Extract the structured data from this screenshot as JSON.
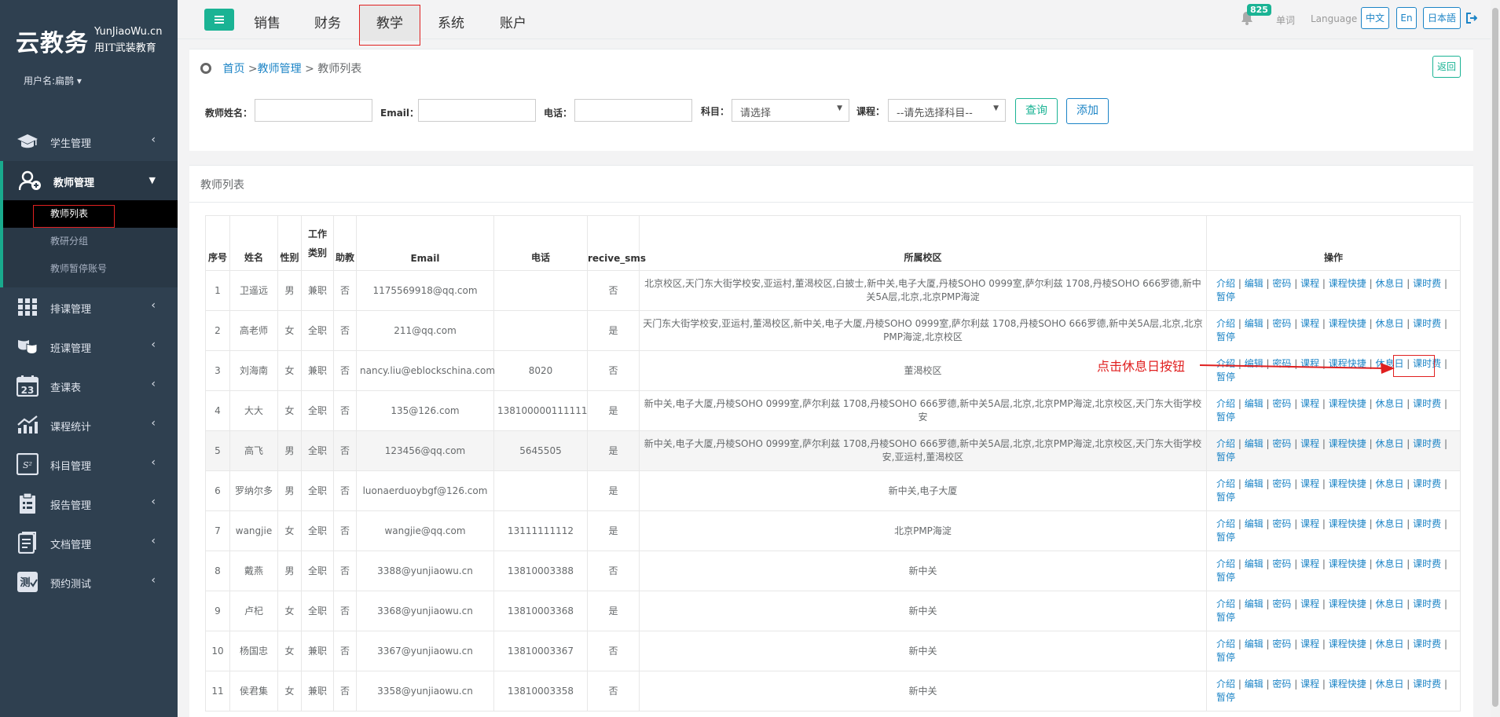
{
  "app": {
    "logo_cn": "云教务",
    "logo_en": "YunJiaoWu.cn",
    "slogan": "用IT武装教育",
    "user_label": "用户名:扁鹊 ▾"
  },
  "sidebar": {
    "items": [
      {
        "label": "学生管理",
        "icon": "graduation-cap-icon"
      },
      {
        "label": "教师管理",
        "icon": "teacher-icon"
      },
      {
        "label": "排课管理",
        "icon": "grid-icon"
      },
      {
        "label": "班课管理",
        "icon": "masks-icon"
      },
      {
        "label": "查课表",
        "icon": "calendar-icon"
      },
      {
        "label": "课程统计",
        "icon": "chart-icon"
      },
      {
        "label": "科目管理",
        "icon": "formula-icon"
      },
      {
        "label": "报告管理",
        "icon": "clipboard-icon"
      },
      {
        "label": "文档管理",
        "icon": "document-icon"
      },
      {
        "label": "预约测试",
        "icon": "test-icon"
      }
    ],
    "teacher_sub": [
      "教师列表",
      "教研分组",
      "教师暂停账号"
    ]
  },
  "topnav": {
    "tabs": [
      "销售",
      "财务",
      "教学",
      "系统",
      "账户"
    ],
    "active": "教学",
    "badge": "825",
    "vocab": "单词",
    "language_label": "Language :",
    "langs": [
      "中文",
      "En",
      "日本語"
    ]
  },
  "breadcrumb": {
    "home": "首页",
    "sep1": " >",
    "parent": "教师管理",
    "sep2": " > ",
    "current": "教师列表",
    "back": "返回"
  },
  "filters": {
    "name_label": "教师姓名：",
    "email_label": "Email：",
    "phone_label": "电话：",
    "subject_label": "科目：",
    "subject_value": "请选择",
    "course_label": "课程：",
    "course_value": "--请先选择科目--",
    "query_btn": "查询",
    "add_btn": "添加"
  },
  "list": {
    "title": "教师列表",
    "headers": [
      "序号",
      "姓名",
      "性别",
      "工作类别",
      "助教",
      "Email",
      "电话",
      "recive_sms",
      "所属校区",
      "操作"
    ],
    "ops": [
      "介绍",
      "编辑",
      "密码",
      "课程",
      "课程快捷",
      "休息日",
      "课时费",
      "暂停"
    ],
    "rows": [
      {
        "no": "1",
        "name": "卫遥远",
        "gender": "男",
        "type": "兼职",
        "assistant": "否",
        "email": "1175569918@qq.com",
        "phone": "",
        "sms": "否",
        "campus": "北京校区,天门东大街学校安,亚运村,董渴校区,白披士,新中关,电子大厦,丹棱SOHO 0999室,萨尔利兹 1708,丹棱SOHO 666罗德,新中关5A层,北京,北京PMP海淀"
      },
      {
        "no": "2",
        "name": "高老师",
        "gender": "女",
        "type": "全职",
        "assistant": "否",
        "email": "211@qq.com",
        "phone": "",
        "sms": "是",
        "campus": "天门东大街学校安,亚运村,董渴校区,新中关,电子大厦,丹棱SOHO 0999室,萨尔利兹 1708,丹棱SOHO 666罗德,新中关5A层,北京,北京PMP海淀,北京校区"
      },
      {
        "no": "3",
        "name": "刘海南",
        "gender": "女",
        "type": "兼职",
        "assistant": "否",
        "email": "nancy.liu@eblockschina.com",
        "phone": "8020",
        "sms": "否",
        "campus": "董渴校区"
      },
      {
        "no": "4",
        "name": "大大",
        "gender": "女",
        "type": "全职",
        "assistant": "否",
        "email": "135@126.com",
        "phone": "138100000111111",
        "sms": "是",
        "campus": "新中关,电子大厦,丹棱SOHO 0999室,萨尔利兹 1708,丹棱SOHO 666罗德,新中关5A层,北京,北京PMP海淀,北京校区,天门东大街学校安"
      },
      {
        "no": "5",
        "name": "高飞",
        "gender": "男",
        "type": "全职",
        "assistant": "否",
        "email": "123456@qq.com",
        "phone": "5645505",
        "sms": "是",
        "campus": "新中关,电子大厦,丹棱SOHO 0999室,萨尔利兹 1708,丹棱SOHO 666罗德,新中关5A层,北京,北京PMP海淀,北京校区,天门东大街学校安,亚运村,董渴校区"
      },
      {
        "no": "6",
        "name": "罗纳尔多",
        "gender": "男",
        "type": "全职",
        "assistant": "否",
        "email": "luonaerduoybgf@126.com",
        "phone": "",
        "sms": "是",
        "campus": "新中关,电子大厦"
      },
      {
        "no": "7",
        "name": "wangjie",
        "gender": "女",
        "type": "全职",
        "assistant": "否",
        "email": "wangjie@qq.com",
        "phone": "13111111112",
        "sms": "是",
        "campus": "北京PMP海淀"
      },
      {
        "no": "8",
        "name": "戴燕",
        "gender": "男",
        "type": "全职",
        "assistant": "否",
        "email": "3388@yunjiaowu.cn",
        "phone": "13810003388",
        "sms": "否",
        "campus": "新中关"
      },
      {
        "no": "9",
        "name": "卢杞",
        "gender": "女",
        "type": "全职",
        "assistant": "否",
        "email": "3368@yunjiaowu.cn",
        "phone": "13810003368",
        "sms": "是",
        "campus": "新中关"
      },
      {
        "no": "10",
        "name": "杨国忠",
        "gender": "女",
        "type": "兼职",
        "assistant": "否",
        "email": "3367@yunjiaowu.cn",
        "phone": "13810003367",
        "sms": "否",
        "campus": "新中关"
      },
      {
        "no": "11",
        "name": "侯君集",
        "gender": "女",
        "type": "兼职",
        "assistant": "否",
        "email": "3358@yunjiaowu.cn",
        "phone": "13810003358",
        "sms": "否",
        "campus": "新中关"
      }
    ]
  },
  "annotation": {
    "text": "点击休息日按钮"
  },
  "colors": {
    "sidebar": "#2f4050",
    "accent": "#1ab394",
    "link": "#1c84c6",
    "annotation": "#e02020"
  }
}
